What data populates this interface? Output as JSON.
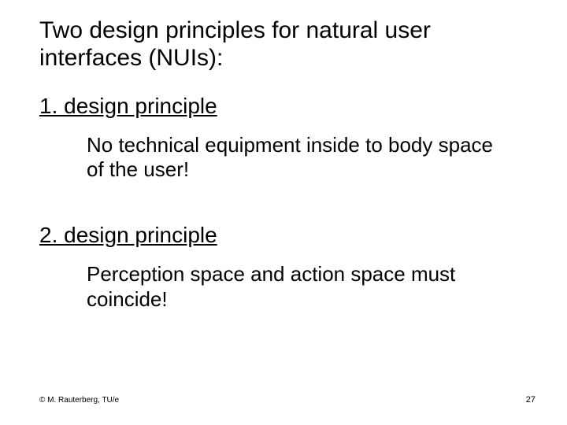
{
  "title": "Two design principles for natural user interfaces (NUIs):",
  "principles": [
    {
      "heading": "1. design principle",
      "body": "No technical equipment inside to body space of the user!"
    },
    {
      "heading": "2. design principle",
      "body": "Perception space and action space must coincide!"
    }
  ],
  "footer": {
    "copyright": "© M. Rauterberg, TU/e",
    "page": "27"
  }
}
